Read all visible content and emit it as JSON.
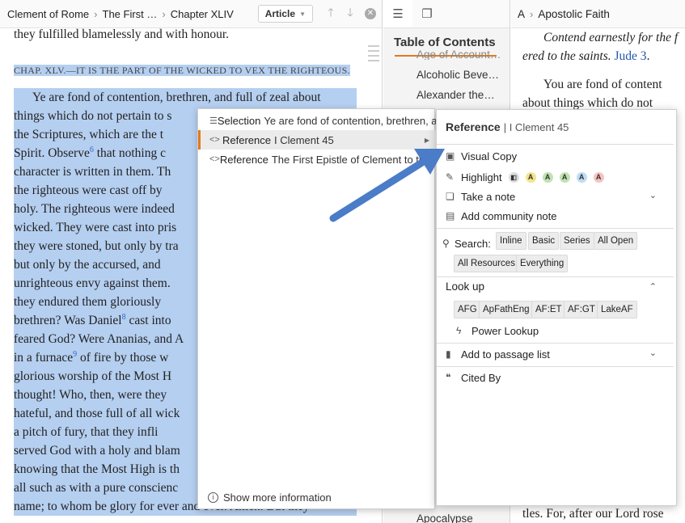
{
  "left_toolbar": {
    "crumbs": [
      "Clement of Rome",
      "The First …",
      "Chapter XLIV"
    ],
    "article_label": "Article"
  },
  "left_text": {
    "lines": [
      "they fulfilled blamelessly and with honour.",
      "CHAP. XLV.—IT IS THE PART OF THE WICKED TO VEX THE RIGHTEOUS.",
      "Ye are fond of contention, brethren, and full of zeal about",
      "things which do not pertain to s",
      "the Scriptures, which are the t",
      "Spirit. Observe",
      "character is written in them. Th",
      "the righteous were cast off by",
      "holy. The righteous were indeed",
      "wicked. They were cast into pris",
      "they were stoned, but only by tra",
      "but only by the accursed, and",
      "unrighteous envy against them.",
      "they endured them gloriously",
      "brethren? Was Daniel",
      "feared God? Were Ananias, and A",
      "in a furnace",
      "glorious worship of the Most H",
      "thought! Who, then, were they",
      "hateful, and those full of all wick",
      "a pitch of fury, that they infli",
      "served God with a holy and blam",
      "knowing that the Most High is th",
      "all such as with a pure conscienc",
      "name; to whom be glory for ever and ever. Amen. But they"
    ],
    "observe_tail": "that nothing c",
    "daniel_tail": "cast into",
    "furnace_tail": "of fire by those w",
    "fn6": "6",
    "fn8": "8",
    "fn9": "9"
  },
  "toc": {
    "title": "Table of Contents",
    "items": [
      "Age of Accountability",
      "Alcoholic Beve…",
      "Alexander the…",
      "Apocalypse"
    ]
  },
  "right_toolbar": {
    "prefix": "A",
    "title": "Apostolic Faith"
  },
  "right_text": {
    "l1": "Contend earnestly for the f",
    "l2a": "ered to the saints.",
    "l2b": "Jude 3",
    "l3": "You are fond of content",
    "l4": "about things which do not",
    "bottom": "tles. For, after our Lord rose"
  },
  "context_menu": {
    "rows": [
      {
        "kind": "Selection",
        "value": "Ye are fond of contention, brethren, and full of zeal"
      },
      {
        "kind": "Reference",
        "value": "I Clement 45"
      },
      {
        "kind": "Reference",
        "value": "The First Epistle of Clement to the Corinthians"
      }
    ],
    "show_more": "Show more information"
  },
  "submenu": {
    "title": "Reference",
    "ref": "I Clement 45",
    "visual_copy": "Visual Copy",
    "highlight": "Highlight",
    "swatch_letter": "A",
    "take_note": "Take a note",
    "community_note": "Add community note",
    "search_label": "Search:",
    "search_chips": [
      "Inline",
      "Basic",
      "Series",
      "All Open",
      "All Resources",
      "Everything"
    ],
    "lookup_label": "Look up",
    "lookup_chips": [
      "AFG",
      "ApFathEng",
      "AF:ET",
      "AF:GT",
      "LakeAF"
    ],
    "power_lookup": "Power Lookup",
    "passage_list": "Add to passage list",
    "cited_by": "Cited By"
  },
  "colors": {
    "selection_highlight": "#b5cff0",
    "accent_orange": "#e07a1f",
    "arrow_blue": "#4a7cc7",
    "swatches": [
      "#f4e48a",
      "#bfe3b0",
      "#bfe3b0",
      "#bfdcf2",
      "#f6c3c3"
    ]
  }
}
